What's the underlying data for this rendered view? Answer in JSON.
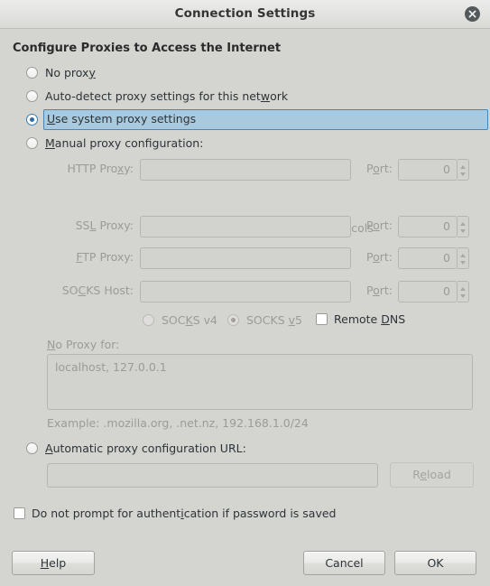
{
  "window": {
    "title": "Connection Settings",
    "close_icon": "close-icon"
  },
  "heading": "Configure Proxies to Access the Internet",
  "proxy_mode": {
    "options": [
      {
        "label_pre": "No prox",
        "label_acc": "y",
        "label_post": "",
        "selected": false,
        "enabled": true
      },
      {
        "label_pre": "Auto-detect proxy settings for this net",
        "label_acc": "w",
        "label_post": "ork",
        "selected": false,
        "enabled": true
      },
      {
        "label_pre": "",
        "label_acc": "U",
        "label_post": "se system proxy settings",
        "selected": true,
        "enabled": true
      },
      {
        "label_pre": "",
        "label_acc": "M",
        "label_post": "anual proxy configuration:",
        "selected": false,
        "enabled": true
      }
    ]
  },
  "manual": {
    "http": {
      "label_pre": "HTTP Pro",
      "label_acc": "x",
      "label_post": "y:",
      "value": "",
      "port_label_pre": "P",
      "port_label_acc": "o",
      "port_label_post": "rt:",
      "port_value": "0",
      "enabled": false
    },
    "use_for_all": {
      "label_pre": "U",
      "label_acc": "s",
      "label_post": "e this proxy server for all protocols",
      "checked": false,
      "enabled": false
    },
    "ssl": {
      "label_pre": "SS",
      "label_acc": "L",
      "label_post": " Proxy:",
      "value": "",
      "port_label_pre": "P",
      "port_label_acc": "o",
      "port_label_post": "rt:",
      "port_value": "0",
      "enabled": false
    },
    "ftp": {
      "label_pre": "",
      "label_acc": "F",
      "label_post": "TP Proxy:",
      "value": "",
      "port_label_pre": "P",
      "port_label_acc": "o",
      "port_label_post": "rt:",
      "port_value": "0",
      "enabled": false
    },
    "socks": {
      "label_pre": "SO",
      "label_acc": "C",
      "label_post": "KS Host:",
      "value": "",
      "port_label_pre": "P",
      "port_label_acc": "o",
      "port_label_post": "rt:",
      "port_value": "0",
      "enabled": false
    },
    "socks_version": [
      {
        "label_pre": "SOC",
        "label_acc": "K",
        "label_post": "S v4",
        "selected": false,
        "enabled": false
      },
      {
        "label_pre": "SOCKS ",
        "label_acc": "v",
        "label_post": "5",
        "selected": true,
        "enabled": false
      }
    ],
    "remote_dns": {
      "label_pre": "Remote ",
      "label_acc": "D",
      "label_post": "NS",
      "checked": false,
      "enabled": true
    },
    "no_proxy": {
      "label_pre": "",
      "label_acc": "N",
      "label_post": "o Proxy for:",
      "value": "localhost, 127.0.0.1",
      "example": "Example: .mozilla.org, .net.nz, 192.168.1.0/24",
      "enabled": false
    }
  },
  "auto_config": {
    "radio_pre": "",
    "radio_acc": "A",
    "radio_post": "utomatic proxy configuration URL:",
    "selected": false,
    "url_value": "",
    "reload_pre": "R",
    "reload_acc": "e",
    "reload_post": "load",
    "reload_enabled": false
  },
  "no_prompt": {
    "label_pre": "Do not prompt for authent",
    "label_acc": "i",
    "label_post": "cation if password is saved",
    "checked": false,
    "enabled": true
  },
  "buttons": {
    "help_pre": "",
    "help_acc": "H",
    "help_post": "elp",
    "cancel": "Cancel",
    "ok": "OK"
  },
  "colors": {
    "dialog_bg": "#d4d4d1",
    "selection_bg": "#a9c9de",
    "selection_border": "#4a87b5",
    "radio_dot": "#2b6ea8",
    "disabled_text": "#9b9b97",
    "text": "#2e3436"
  }
}
